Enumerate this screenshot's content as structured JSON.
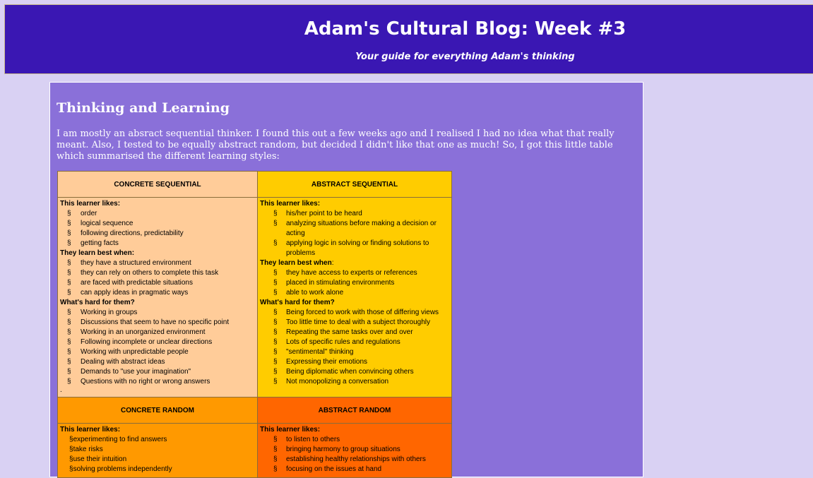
{
  "header": {
    "title": "Adam's Cultural Blog: Week #3",
    "subtitle": "Your guide for everything Adam's thinking"
  },
  "post": {
    "title": "Thinking and Learning",
    "intro": "I am mostly an absract sequential thinker. I found this out a few weeks ago and I realised I had no idea what that really meant. Also, I tested to be equally abstract random, but decided I didn't like that one as much! So, I got this little table which summarised the different learning styles:"
  },
  "table": {
    "bullet": "§",
    "concrete_sequential": {
      "title": "CONCRETE SEQUENTIAL",
      "likes_label": "This learner likes:",
      "likes": [
        "order",
        "logical sequence",
        "following directions, predictability",
        "getting facts"
      ],
      "best_label": "They learn best when:",
      "best": [
        "they have a structured environment",
        "they can rely on others to complete this task",
        "are faced with predictable situations",
        "can apply ideas in pragmatic ways"
      ],
      "hard_label": "What's hard for them?",
      "hard": [
        "Working in groups",
        "Discussions that seem to have no specific point",
        "Working in an unorganized environment",
        "Following incomplete or unclear directions",
        "Working with unpredictable people",
        "Dealing with abstract ideas",
        "Demands to \"use your imagination\"",
        "Questions with no right or wrong answers"
      ],
      "trailing": "."
    },
    "abstract_sequential": {
      "title": "ABSTRACT SEQUENTIAL",
      "likes_label": "This learner likes:",
      "likes": [
        "his/her point to be heard",
        "analyzing situations before making a decision or acting",
        "applying logic in solving or finding solutions to problems"
      ],
      "best_label_bold": "They learn best when",
      "best_label_rest": ":",
      "best": [
        "they have access to experts or references",
        "placed in stimulating environments",
        "able to work alone"
      ],
      "hard_label": "What's hard for them?",
      "hard": [
        "Being forced to work with those of differing views",
        "Too little time to deal with a subject thoroughly",
        "Repeating the same tasks over and over",
        "Lots of specific rules and regulations",
        "\"sentimental\" thinking",
        "Expressing their emotions",
        "Being diplomatic when convincing others",
        "Not monopolizing a conversation"
      ]
    },
    "concrete_random": {
      "title": "CONCRETE RANDOM",
      "likes_label": "This learner likes:",
      "likes": [
        "experimenting to find answers",
        "take risks",
        "use their intuition",
        "solving problems independently"
      ]
    },
    "abstract_random": {
      "title": "ABSTRACT RANDOM",
      "likes_label": "This learner likes:",
      "likes": [
        "to listen to others",
        "bringing harmony to group situations",
        "establishing healthy relationships with others",
        "focusing on the issues at hand"
      ]
    }
  }
}
